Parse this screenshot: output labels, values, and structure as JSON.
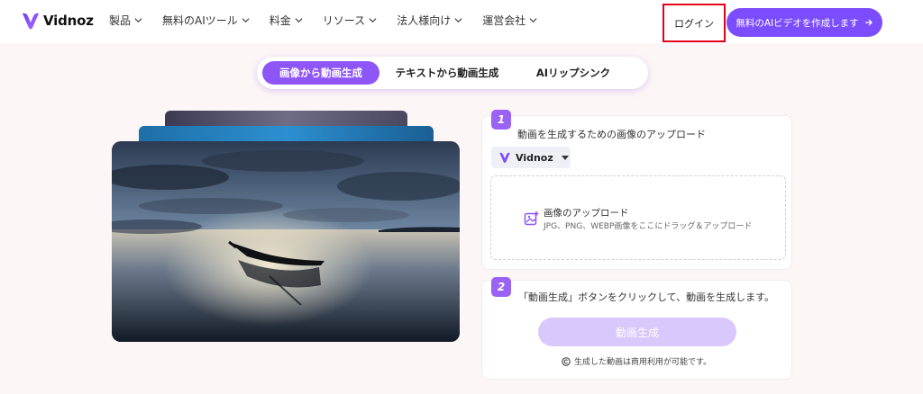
{
  "header": {
    "brand": "Vidnoz",
    "nav": [
      {
        "label": "製品"
      },
      {
        "label": "無料のAIツール"
      },
      {
        "label": "料金"
      },
      {
        "label": "リソース"
      },
      {
        "label": "法人様向け"
      },
      {
        "label": "運営会社"
      }
    ],
    "login_label": "ログイン",
    "cta_label": "無料のAIビデオを作成します"
  },
  "tabs": [
    {
      "label": "画像から動画生成",
      "active": true
    },
    {
      "label": "テキストから動画生成",
      "active": false
    },
    {
      "label": "AIリップシンク",
      "active": false
    }
  ],
  "step1": {
    "number": "1",
    "title": "動画を生成するための画像のアップロード",
    "select_value": "Vidnoz",
    "upload_title": "画像のアップロード",
    "upload_sub": "JPG、PNG、WEBP画像をここにドラッグ＆アップロード"
  },
  "step2": {
    "number": "2",
    "title": "「動画生成」ボタンをクリックして、動画を生成します。",
    "button_label": "動画生成",
    "note": "生成した動画は商用利用が可能です。"
  },
  "colors": {
    "accent": "#7c4dff",
    "tab_active": "#8e55f7",
    "badge": "#9a63f5",
    "button_disabled": "#d9c8fb",
    "highlight_border": "#e3001b"
  }
}
